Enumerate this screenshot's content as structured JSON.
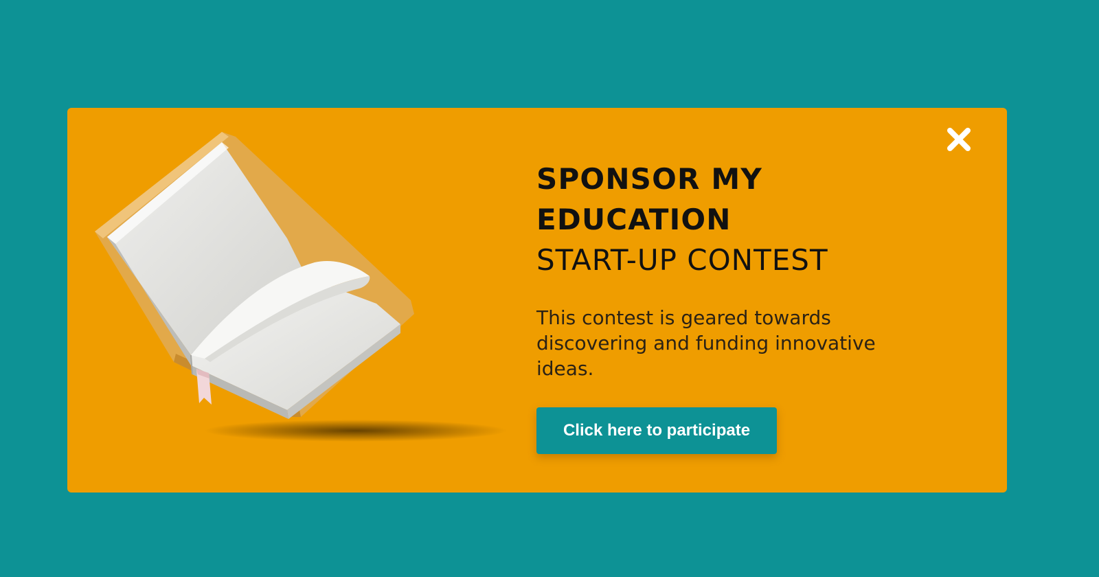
{
  "popup": {
    "title_line_1": "SPONSOR MY",
    "title_line_2": "EDUCATION",
    "title_line_3": "START-UP CONTEST",
    "description": "This contest is geared towards discovering and funding innovative ideas.",
    "cta_label": "Click here to participate",
    "close_icon": "close-icon",
    "illustration": "open-book-icon"
  },
  "colors": {
    "page_background": "#0d9295",
    "popup_background": "#ef9d00",
    "button_background": "#0d9295",
    "button_text": "#ffffff",
    "heading_text": "#111111"
  }
}
